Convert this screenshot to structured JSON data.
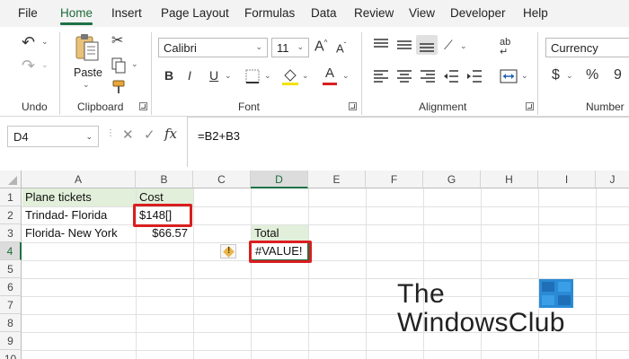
{
  "menu": {
    "tabs": [
      {
        "label": "File",
        "active": false
      },
      {
        "label": "Home",
        "active": true
      },
      {
        "label": "Insert",
        "active": false
      },
      {
        "label": "Page Layout",
        "active": false
      },
      {
        "label": "Formulas",
        "active": false
      },
      {
        "label": "Data",
        "active": false
      },
      {
        "label": "Review",
        "active": false
      },
      {
        "label": "View",
        "active": false
      },
      {
        "label": "Developer",
        "active": false
      },
      {
        "label": "Help",
        "active": false
      }
    ]
  },
  "ribbon": {
    "groups": {
      "undo": "Undo",
      "clipboard": "Clipboard",
      "font": "Font",
      "alignment": "Alignment",
      "number": "Number"
    },
    "paste_label": "Paste",
    "font_name": "Calibri",
    "font_size": "11",
    "number_format": "Currency",
    "bold": "B",
    "italic": "I",
    "underline": "U",
    "font_grow": "A",
    "font_shrink": "A",
    "font_color_letter": "A",
    "currency_symbol": "$",
    "percent_symbol": "%",
    "comma_symbol": "9",
    "wrap_label": "ab",
    "accent_color": "#1e7145",
    "font_color_bar": "#d91f1f"
  },
  "formula_bar": {
    "name_box": "D4",
    "cancel": "✕",
    "enter": "✓",
    "fx": "fx",
    "formula": "=B2+B3"
  },
  "sheet": {
    "columns": [
      "A",
      "B",
      "C",
      "D",
      "E",
      "F",
      "G",
      "H",
      "I",
      "J"
    ],
    "rows": [
      "1",
      "2",
      "3",
      "4",
      "5",
      "6",
      "7",
      "8",
      "9",
      "10"
    ],
    "selected_column": "D",
    "selected_row": "4",
    "cells": {
      "A1": "Plane tickets",
      "B1": "Cost",
      "A2": "Trindad- Florida",
      "B2": "$148[]",
      "A3": "Florida- New York",
      "B3": "$66.57",
      "D3": "Total",
      "D4": "#VALUE!"
    },
    "warning_glyph": "!"
  },
  "watermark": {
    "line1": "The",
    "line2": "WindowsClub"
  }
}
